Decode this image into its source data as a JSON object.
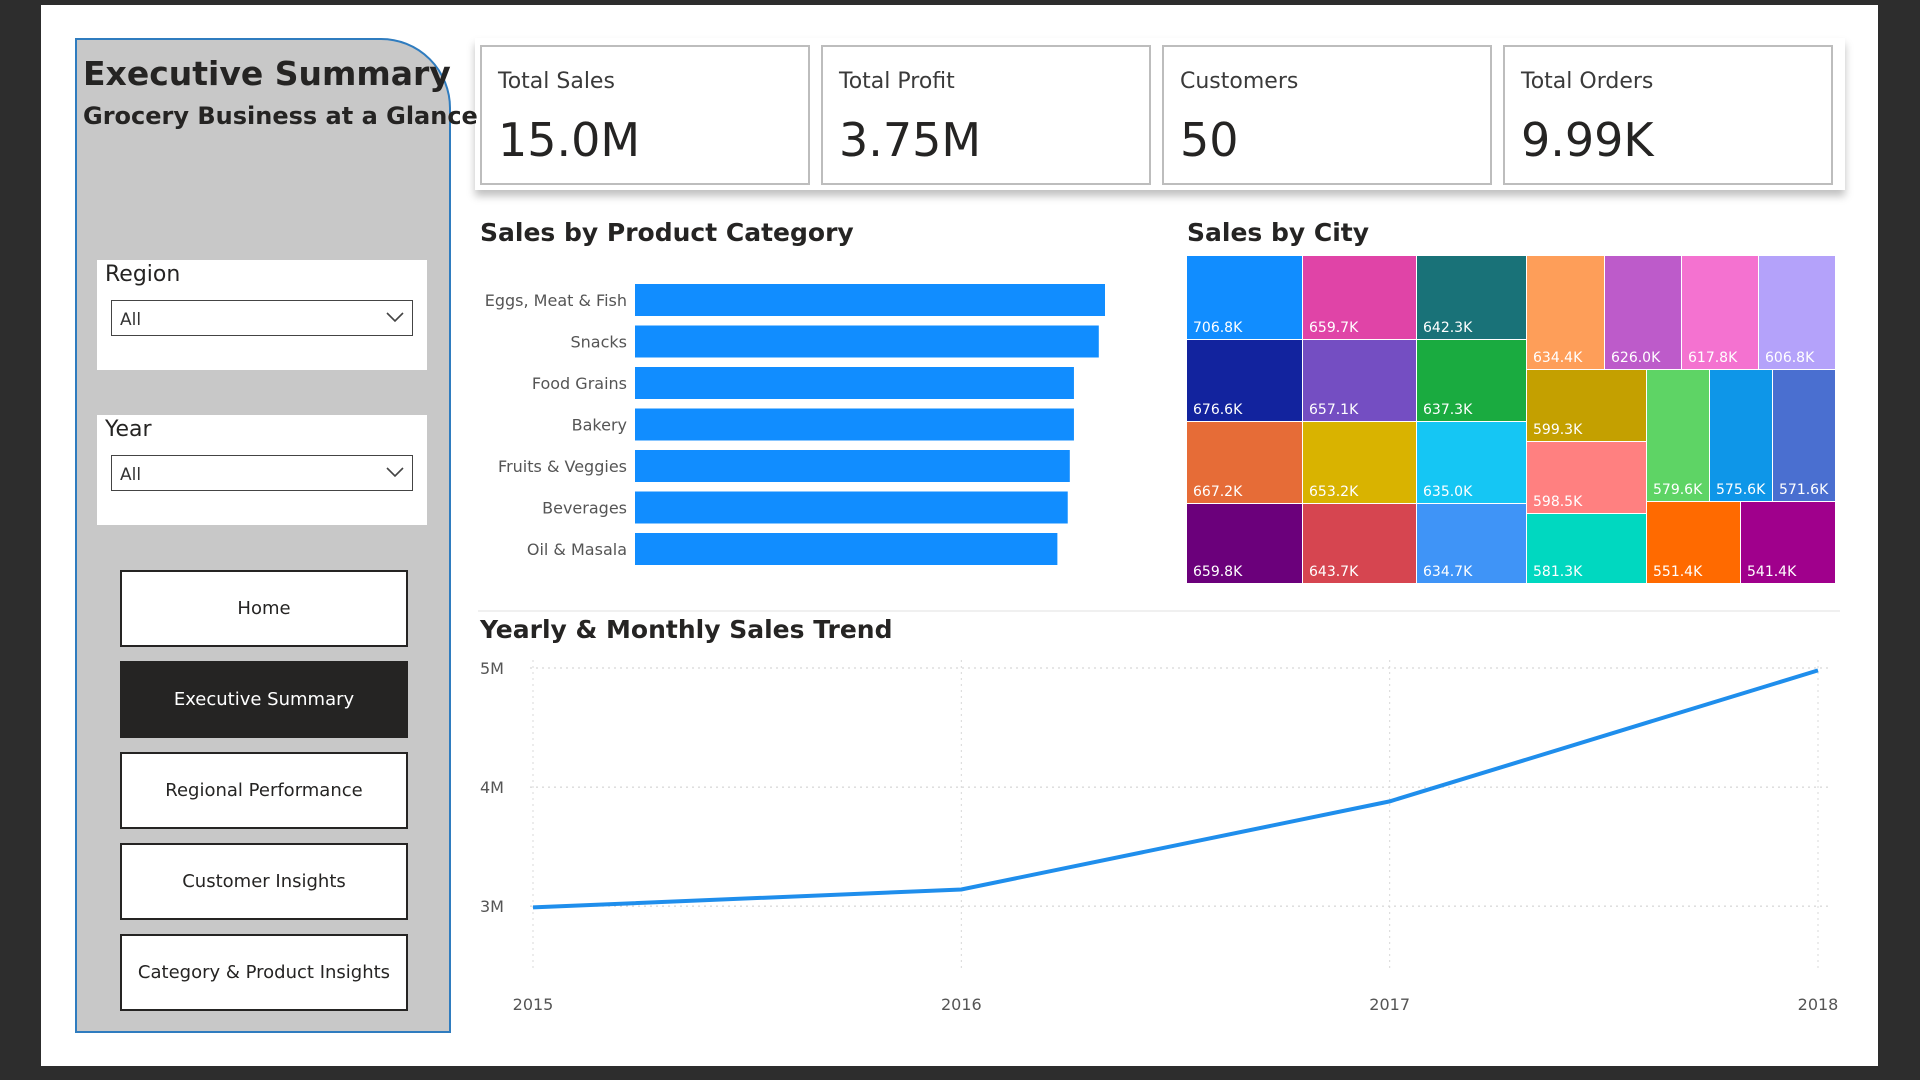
{
  "sidebar": {
    "title": "Executive Summary",
    "subtitle": "Grocery Business at a Glance",
    "filters": [
      {
        "label": "Region",
        "value": "All"
      },
      {
        "label": "Year",
        "value": "All"
      }
    ],
    "nav": [
      {
        "label": "Home",
        "active": false
      },
      {
        "label": "Executive Summary",
        "active": true
      },
      {
        "label": "Regional Performance",
        "active": false
      },
      {
        "label": "Customer Insights",
        "active": false
      },
      {
        "label": "Category & Product Insights",
        "active": false
      }
    ]
  },
  "kpis": [
    {
      "label": "Total Sales",
      "value": "15.0M"
    },
    {
      "label": "Total Profit",
      "value": "3.75M"
    },
    {
      "label": "Customers",
      "value": "50"
    },
    {
      "label": "Total Orders",
      "value": "9.99K"
    }
  ],
  "colors": {
    "bar": "#118DFF",
    "line": "#1F8EEC",
    "active_nav": "#252423",
    "sidebar_bg": "#C8C8C8",
    "sidebar_border": "#2F7CBF"
  },
  "chart_data": [
    {
      "type": "bar",
      "orientation": "horizontal",
      "title": "Sales by Product Category",
      "categories": [
        "Eggs, Meat & Fish",
        "Snacks",
        "Food Grains",
        "Bakery",
        "Fruits & Veggies",
        "Beverages",
        "Oil & Masala"
      ],
      "values": [
        2.27,
        2.24,
        2.12,
        2.12,
        2.1,
        2.09,
        2.04
      ],
      "xlim": [
        0,
        2.27
      ]
    },
    {
      "type": "treemap",
      "title": "Sales by City",
      "items": [
        {
          "label": "706.8K",
          "value": 706.8,
          "color": "#118DFF"
        },
        {
          "label": "659.7K",
          "value": 659.7,
          "color": "#E044A7"
        },
        {
          "label": "642.3K",
          "value": 642.3,
          "color": "#197278"
        },
        {
          "label": "634.4K",
          "value": 634.4,
          "color": "#FE9E59"
        },
        {
          "label": "626.0K",
          "value": 626.0,
          "color": "#BD5BCA"
        },
        {
          "label": "617.8K",
          "value": 617.8,
          "color": "#F472D0"
        },
        {
          "label": "606.8K",
          "value": 606.8,
          "color": "#B4A2FA"
        },
        {
          "label": "676.6K",
          "value": 676.6,
          "color": "#12239E"
        },
        {
          "label": "657.1K",
          "value": 657.1,
          "color": "#744EC2"
        },
        {
          "label": "637.3K",
          "value": 637.3,
          "color": "#1AAB40"
        },
        {
          "label": "599.3K",
          "value": 599.3,
          "color": "#C4A000"
        },
        {
          "label": "667.2K",
          "value": 667.2,
          "color": "#E66C37"
        },
        {
          "label": "653.2K",
          "value": 653.2,
          "color": "#D9B300"
        },
        {
          "label": "635.0K",
          "value": 635.0,
          "color": "#15C6F4"
        },
        {
          "label": "598.5K",
          "value": 598.5,
          "color": "#FF8080"
        },
        {
          "label": "579.6K",
          "value": 579.6,
          "color": "#5ED465"
        },
        {
          "label": "575.6K",
          "value": 575.6,
          "color": "#0E96E8"
        },
        {
          "label": "571.6K",
          "value": 571.6,
          "color": "#4A6FD0"
        },
        {
          "label": "659.8K",
          "value": 659.8,
          "color": "#6B007B"
        },
        {
          "label": "643.7K",
          "value": 643.7,
          "color": "#D64550"
        },
        {
          "label": "634.7K",
          "value": 634.7,
          "color": "#3F94F7"
        },
        {
          "label": "581.3K",
          "value": 581.3,
          "color": "#00D8C0"
        },
        {
          "label": "551.4K",
          "value": 551.4,
          "color": "#FF6A00"
        },
        {
          "label": "541.4K",
          "value": 541.4,
          "color": "#A0008C"
        }
      ]
    },
    {
      "type": "line",
      "title": "Yearly & Monthly Sales Trend",
      "x": [
        "2015",
        "2016",
        "2017",
        "2018"
      ],
      "series": [
        {
          "values": [
            2.99,
            3.14,
            3.88,
            4.98
          ]
        }
      ],
      "yticks": [
        "3M",
        "4M",
        "5M"
      ],
      "ylim": [
        2.8,
        5.0
      ],
      "grid": true
    }
  ]
}
